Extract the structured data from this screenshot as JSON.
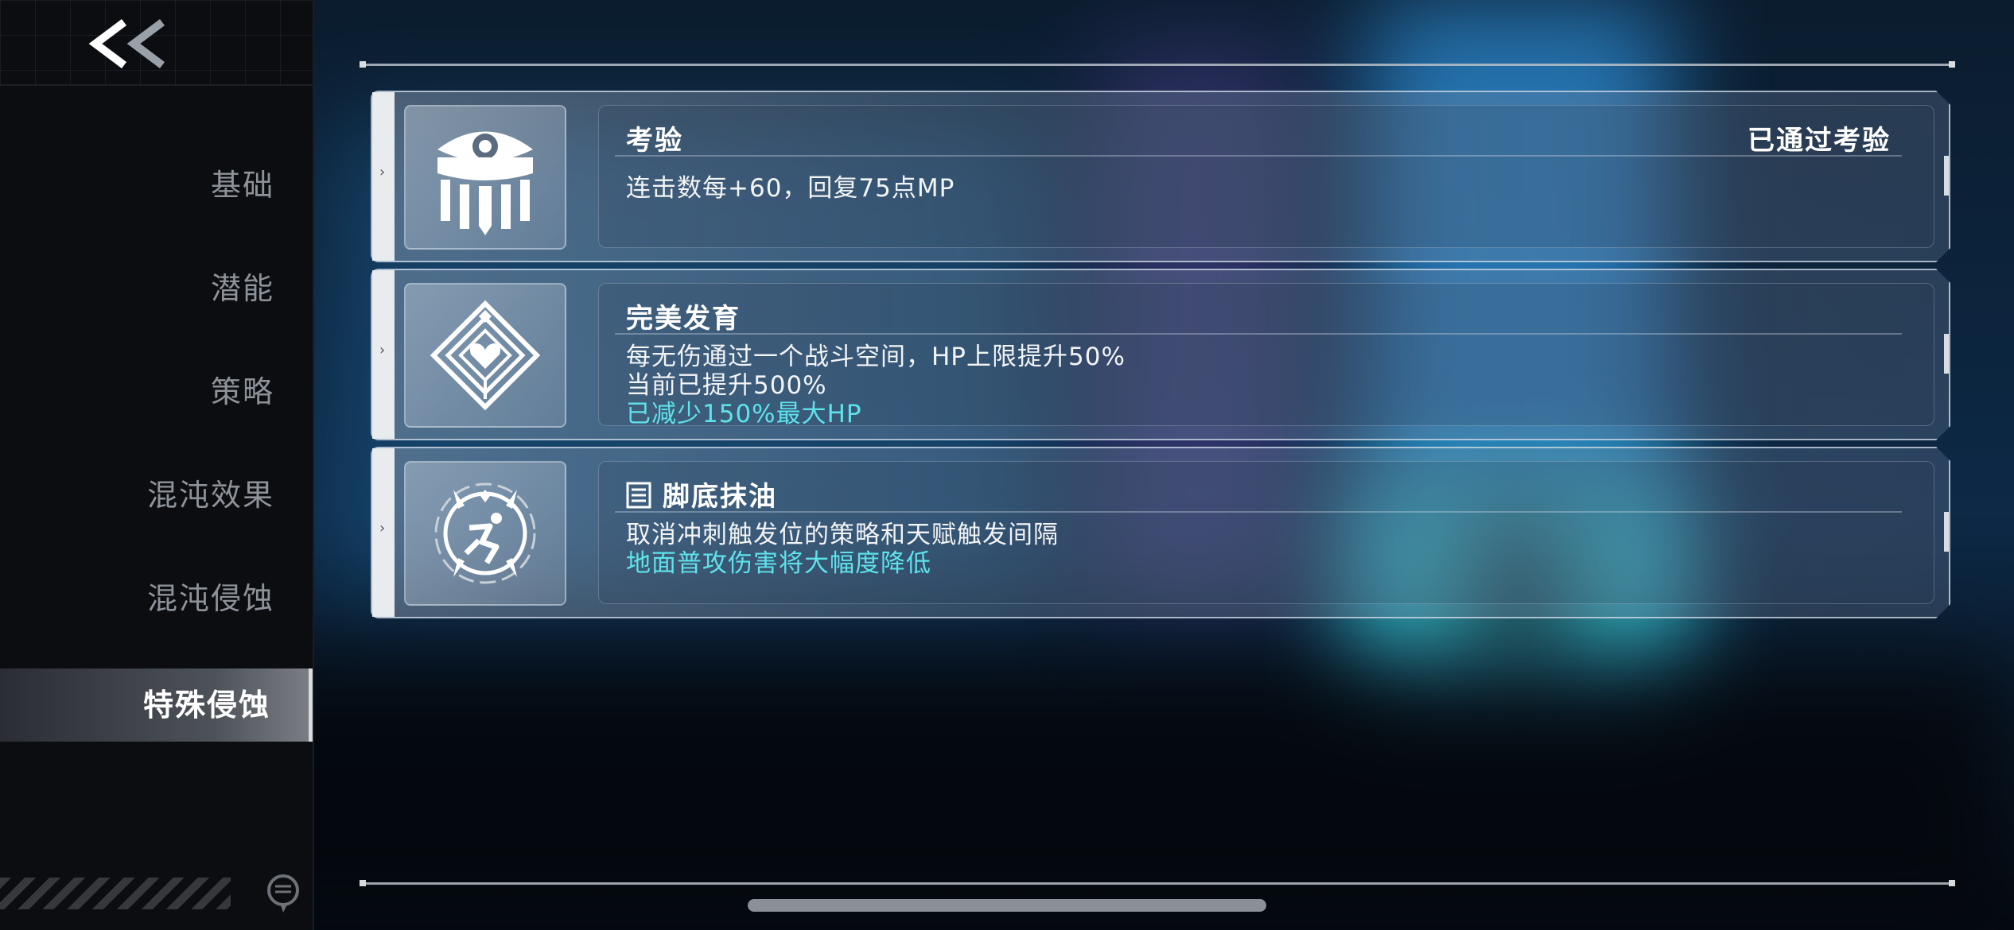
{
  "nav": {
    "items": [
      {
        "label": "基础"
      },
      {
        "label": "潜能"
      },
      {
        "label": "策略"
      },
      {
        "label": "混沌效果"
      },
      {
        "label": "混沌侵蚀"
      },
      {
        "label": "特殊侵蚀"
      }
    ],
    "active_index": 5
  },
  "cards": [
    {
      "title": "考验",
      "status": "已通过考验",
      "icon": "eye-crest-icon",
      "lines": [
        "连击数每+60，回复75点MP"
      ]
    },
    {
      "title": "完美发育",
      "icon": "diamond-heart-icon",
      "lines": [
        "每无伤通过一个战斗空间，HP上限提升50%",
        "当前已提升500%"
      ],
      "highlight": "已减少150%最大HP"
    },
    {
      "title": "脚底抹油",
      "title_icon": "book-icon",
      "icon": "dash-runner-icon",
      "lines": [
        "取消冲刺触发位的策略和天赋触发间隔"
      ],
      "highlight": "地面普攻伤害将大幅度降低"
    }
  ],
  "colors": {
    "highlight": "#5fe3ea",
    "active_nav_text": "#ffffff",
    "nav_text": "#8e939a"
  }
}
